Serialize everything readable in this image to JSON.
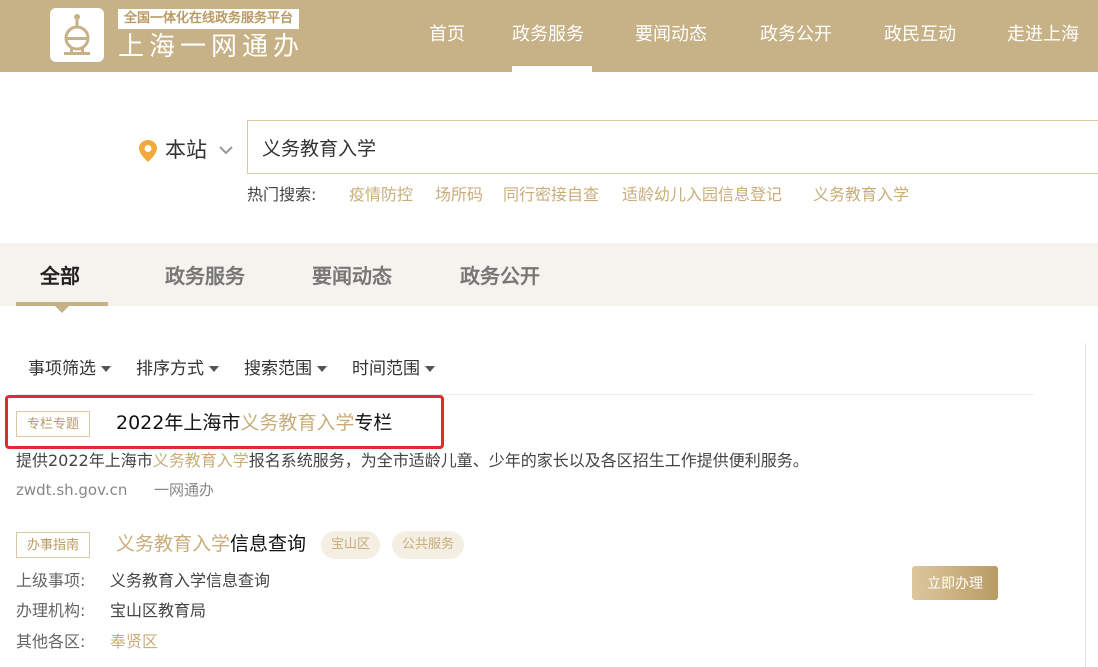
{
  "header": {
    "tagline": "全国一体化在线政务服务平台",
    "site_name": "上海一网通办",
    "logo_icon": "e-logo-icon",
    "nav": [
      {
        "label": "首页"
      },
      {
        "label": "政务服务"
      },
      {
        "label": "要闻动态"
      },
      {
        "label": "政务公开"
      },
      {
        "label": "政民互动"
      },
      {
        "label": "走进上海"
      }
    ],
    "active_nav": "政务服务",
    "brand_color": "#c7b186"
  },
  "search": {
    "scope": "本站",
    "query": "义务教育入学",
    "hot_label": "热门搜索:",
    "hot_items": [
      "疫情防控",
      "场所码",
      "同行密接自查",
      "适龄幼儿入园信息登记",
      "义务教育入学"
    ]
  },
  "tabs": [
    {
      "label": "全部"
    },
    {
      "label": "政务服务"
    },
    {
      "label": "要闻动态"
    },
    {
      "label": "政务公开"
    }
  ],
  "active_tab": "全部",
  "filters": [
    "事项筛选",
    "排序方式",
    "搜索范围",
    "时间范围"
  ],
  "results": [
    {
      "tag": "专栏专题",
      "title_pre": "2022年上海市",
      "title_hl": "义务教育入学",
      "title_post": "专栏",
      "desc_pre": "提供2022年上海市",
      "desc_hl": "义务教育入学",
      "desc_post": "报名系统服务，为全市适龄儿童、少年的家长以及各区招生工作提供便利服务。",
      "url": "zwdt.sh.gov.cn",
      "source": "一网通办"
    },
    {
      "tag": "办事指南",
      "title_hl": "义务教育入学",
      "title_post": "信息查询",
      "badges": [
        "宝山区",
        "公共服务"
      ],
      "meta": [
        {
          "label": "上级事项:",
          "value": "义务教育入学信息查询"
        },
        {
          "label": "办理机构:",
          "value": "宝山区教育局"
        },
        {
          "label": "其他各区:",
          "value": "奉贤区"
        }
      ],
      "action": "立即办理"
    }
  ],
  "colors": {
    "highlight": "#c8ad7a",
    "annotation_box": "#e12a2a"
  }
}
